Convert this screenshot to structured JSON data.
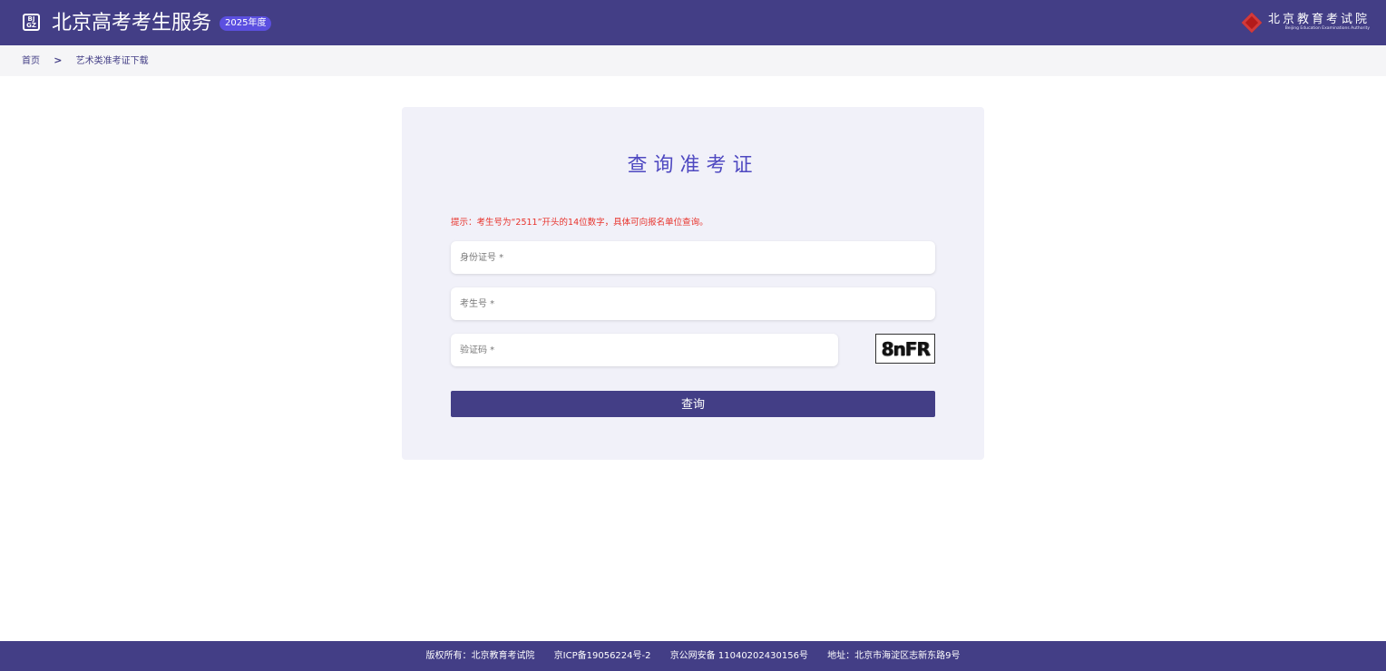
{
  "header": {
    "logo_top": "BJ",
    "logo_bottom": "GZ",
    "title": "北京高考考生服务",
    "year_badge": "2025年度",
    "org_name_cn": "北京教育考试院",
    "org_name_en": "Beijing Education Examinations Authority"
  },
  "breadcrumb": {
    "home": "首页",
    "separator": ">",
    "current": "艺术类准考证下载"
  },
  "form": {
    "title": "查询准考证",
    "hint": "提示：考生号为“2511”开头的14位数字，具体可向报名单位查询。",
    "id_card_placeholder": "身份证号 *",
    "exam_no_placeholder": "考生号 *",
    "captcha_placeholder": "验证码 *",
    "captcha_text": "8nFR",
    "submit_label": "查询"
  },
  "footer": {
    "copyright": "版权所有：北京教育考试院",
    "icp": "京ICP备19056224号-2",
    "police": "京公网安备 11040202430156号",
    "address": "地址：北京市海淀区志新东路9号"
  },
  "colors": {
    "brand": "#433e86",
    "title": "#4f49c1",
    "hint": "#e8322b",
    "card_bg": "#f1f1f9"
  }
}
